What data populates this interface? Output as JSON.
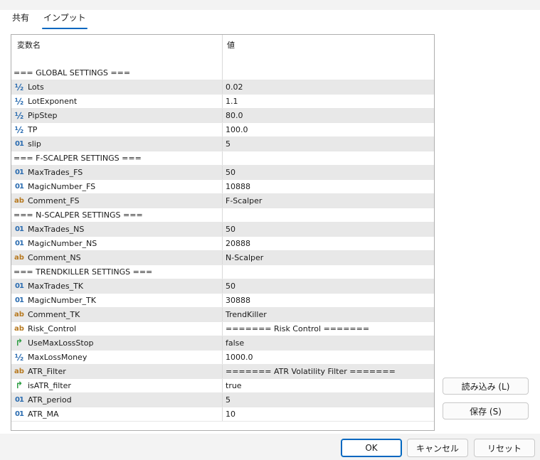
{
  "tabs": [
    {
      "label": "共有",
      "active": false
    },
    {
      "label": "インプット",
      "active": true
    }
  ],
  "table": {
    "headers": {
      "name": "変数名",
      "value": "値"
    },
    "rows": [
      {
        "icon": "",
        "name": "=== GLOBAL SETTINGS ===",
        "value": ""
      },
      {
        "icon": "double-icon",
        "name": "Lots",
        "value": "0.02"
      },
      {
        "icon": "double-icon",
        "name": "LotExponent",
        "value": "1.1"
      },
      {
        "icon": "double-icon",
        "name": "PipStep",
        "value": "80.0"
      },
      {
        "icon": "double-icon",
        "name": "TP",
        "value": "100.0"
      },
      {
        "icon": "integer-icon",
        "name": "slip",
        "value": "5"
      },
      {
        "icon": "",
        "name": "=== F-SCALPER SETTINGS ===",
        "value": ""
      },
      {
        "icon": "integer-icon",
        "name": "MaxTrades_FS",
        "value": "50"
      },
      {
        "icon": "integer-icon",
        "name": "MagicNumber_FS",
        "value": "10888"
      },
      {
        "icon": "string-icon",
        "name": "Comment_FS",
        "value": "F-Scalper"
      },
      {
        "icon": "",
        "name": "=== N-SCALPER SETTINGS ===",
        "value": ""
      },
      {
        "icon": "integer-icon",
        "name": "MaxTrades_NS",
        "value": "50"
      },
      {
        "icon": "integer-icon",
        "name": "MagicNumber_NS",
        "value": "20888"
      },
      {
        "icon": "string-icon",
        "name": "Comment_NS",
        "value": "N-Scalper"
      },
      {
        "icon": "",
        "name": "=== TRENDKILLER SETTINGS ===",
        "value": ""
      },
      {
        "icon": "integer-icon",
        "name": "MaxTrades_TK",
        "value": "50"
      },
      {
        "icon": "integer-icon",
        "name": "MagicNumber_TK",
        "value": "30888"
      },
      {
        "icon": "string-icon",
        "name": "Comment_TK",
        "value": "TrendKiller"
      },
      {
        "icon": "string-icon",
        "name": "Risk_Control",
        "value": "======= Risk Control ======="
      },
      {
        "icon": "bool-icon",
        "name": "UseMaxLossStop",
        "value": "false"
      },
      {
        "icon": "double-icon",
        "name": "MaxLossMoney",
        "value": "1000.0"
      },
      {
        "icon": "string-icon",
        "name": "ATR_Filter",
        "value": "======= ATR Volatility Filter ======="
      },
      {
        "icon": "bool-icon",
        "name": "isATR_filter",
        "value": "true"
      },
      {
        "icon": "integer-icon",
        "name": "ATR_period",
        "value": "5"
      },
      {
        "icon": "integer-icon",
        "name": "ATR_MA",
        "value": "10"
      }
    ]
  },
  "icon_glyphs": {
    "double-icon": "½",
    "integer-icon": "01",
    "string-icon": "ab",
    "bool-icon": "↱"
  },
  "buttons": {
    "load": "読み込み (L)",
    "save": "保存 (S)",
    "ok": "OK",
    "cancel": "キャンセル",
    "reset": "リセット"
  },
  "colors": {
    "accent": "#0067c0",
    "alt_row": "#e8e8e8"
  }
}
